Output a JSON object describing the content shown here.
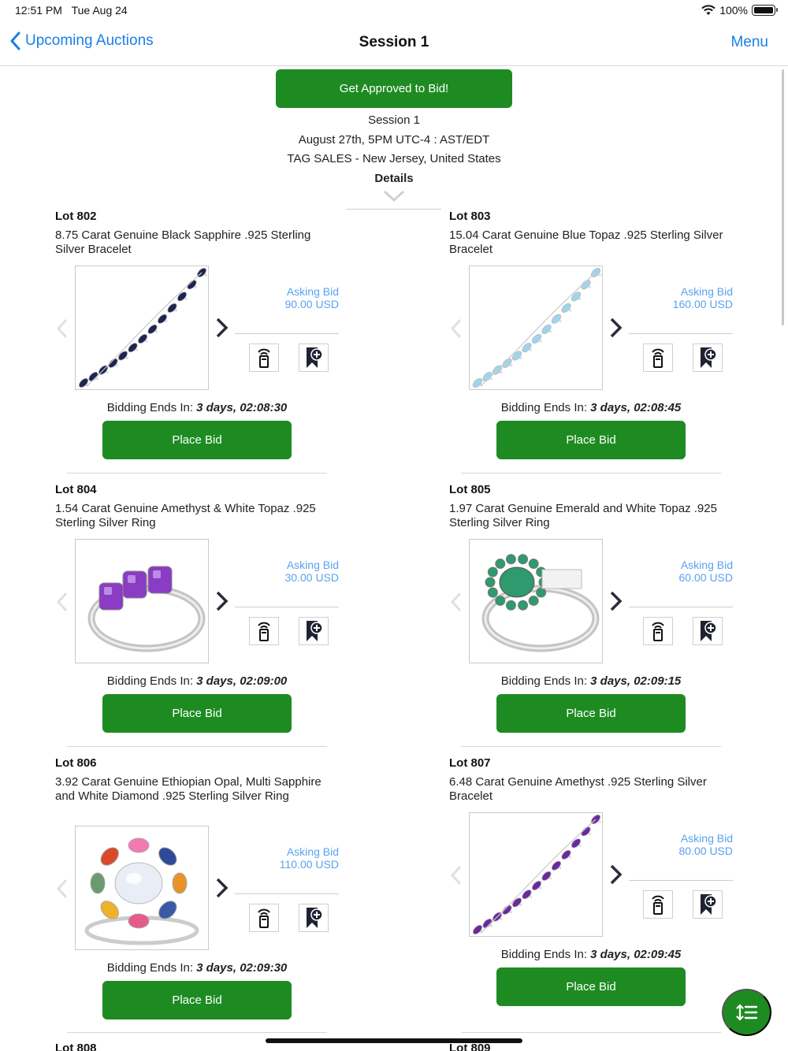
{
  "status": {
    "time": "12:51 PM",
    "date": "Tue Aug 24",
    "battery": "100%"
  },
  "nav": {
    "back_label": "Upcoming Auctions",
    "title": "Session 1",
    "menu_label": "Menu"
  },
  "header": {
    "approve_label": "Get Approved to Bid!",
    "session": "Session 1",
    "datetime": "August 27th, 5PM UTC-4 : AST/EDT",
    "location": "TAG SALES - New Jersey, United States",
    "details_label": "Details"
  },
  "labels": {
    "asking_bid": "Asking Bid",
    "bidding_ends": "Bidding Ends In:",
    "place_bid": "Place Bid"
  },
  "lots": [
    {
      "lot": "Lot 802",
      "title": "8.75 Carat Genuine Black Sapphire .925 Sterling Silver Bracelet",
      "asking": "90.00 USD",
      "ends": "3 days, 02:08:30",
      "gem_color": "#1d2550"
    },
    {
      "lot": "Lot 803",
      "title": "15.04 Carat Genuine Blue Topaz .925 Sterling Silver Bracelet",
      "asking": "160.00 USD",
      "ends": "3 days, 02:08:45",
      "gem_color": "#9fd4ec"
    },
    {
      "lot": "Lot 804",
      "title": "1.54 Carat Genuine Amethyst & White Topaz .925 Sterling Silver Ring",
      "asking": "30.00 USD",
      "ends": "3 days, 02:09:00",
      "gem_color": "#8a3cc4"
    },
    {
      "lot": "Lot 805",
      "title": "1.97 Carat Genuine Emerald and White Topaz .925 Sterling Silver Ring",
      "asking": "60.00 USD",
      "ends": "3 days, 02:09:15",
      "gem_color": "#2f9a6e"
    },
    {
      "lot": "Lot 806",
      "title": "3.92 Carat Genuine Ethiopian Opal, Multi Sapphire and White Diamond .925 Sterling Silver Ring",
      "asking": "110.00 USD",
      "ends": "3 days, 02:09:30",
      "gem_color": "#e9eef6"
    },
    {
      "lot": "Lot 807",
      "title": "6.48 Carat Genuine Amethyst .925 Sterling Silver Bracelet",
      "asking": "80.00 USD",
      "ends": "3 days, 02:09:45",
      "gem_color": "#6a2a9c"
    },
    {
      "lot": "Lot 808"
    },
    {
      "lot": "Lot 809"
    }
  ]
}
